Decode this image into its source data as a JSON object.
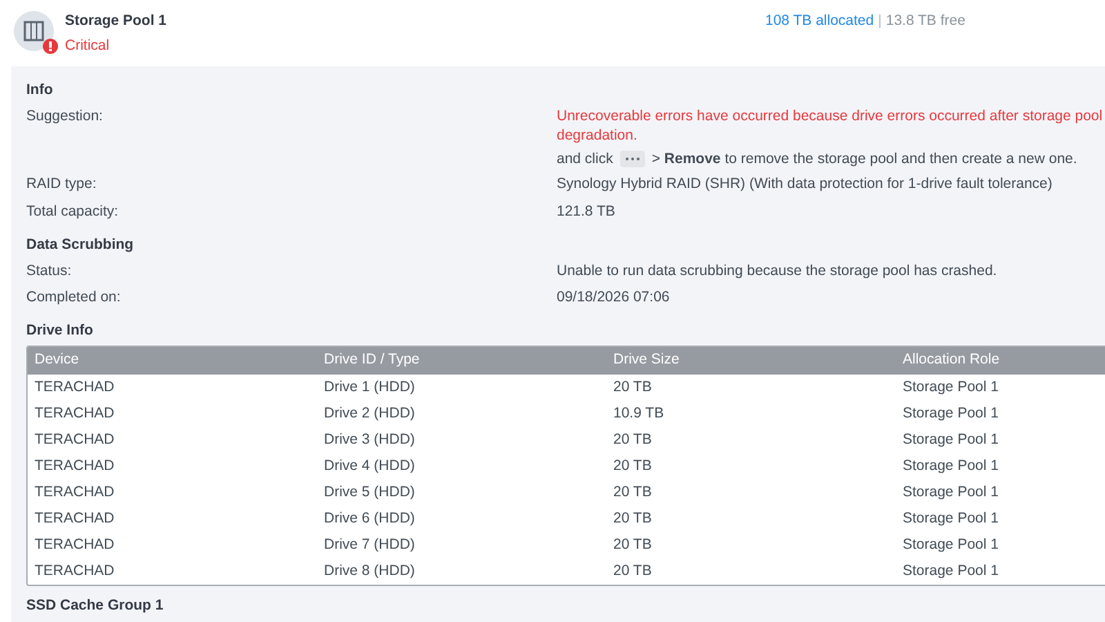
{
  "header": {
    "title": "Storage Pool 1",
    "status": "Critical",
    "allocated": "108 TB allocated",
    "separator": "|",
    "free": "13.8 TB free"
  },
  "info": {
    "title": "Info",
    "rows": [
      {
        "label": "Suggestion:",
        "kind": "suggestion",
        "error": "Unrecoverable errors have occurred because drive errors occurred after storage pool degradation.",
        "before": "and click",
        "after": "> **Remove** to remove the storage pool and then create a new one."
      },
      {
        "label": "RAID type:",
        "kind": "text",
        "value": "Synology Hybrid RAID (SHR) (With data protection for 1-drive fault tolerance)"
      },
      {
        "label": "Total capacity:",
        "kind": "text",
        "value": "121.8 TB"
      }
    ]
  },
  "scrubbing": {
    "title": "Data Scrubbing",
    "rows": [
      {
        "label": "Status:",
        "kind": "text",
        "value": "Unable to run data scrubbing because the storage pool has crashed."
      },
      {
        "label": "Completed on:",
        "kind": "text",
        "value": "09/18/2026 07:06"
      }
    ]
  },
  "drive_info": {
    "title": "Drive Info",
    "table": {
      "columns": [
        "Device",
        "Drive ID / Type",
        "Drive Size",
        "Allocation Role"
      ],
      "rows": [
        [
          "TERACHAD",
          "Drive 1 (HDD)",
          "20 TB",
          "Storage Pool 1"
        ],
        [
          "TERACHAD",
          "Drive 2 (HDD)",
          "10.9 TB",
          "Storage Pool 1"
        ],
        [
          "TERACHAD",
          "Drive 3 (HDD)",
          "20 TB",
          "Storage Pool 1"
        ],
        [
          "TERACHAD",
          "Drive 4 (HDD)",
          "20 TB",
          "Storage Pool 1"
        ],
        [
          "TERACHAD",
          "Drive 5 (HDD)",
          "20 TB",
          "Storage Pool 1"
        ],
        [
          "TERACHAD",
          "Drive 6 (HDD)",
          "20 TB",
          "Storage Pool 1"
        ],
        [
          "TERACHAD",
          "Drive 7 (HDD)",
          "20 TB",
          "Storage Pool 1"
        ],
        [
          "TERACHAD",
          "Drive 8 (HDD)",
          "20 TB",
          "Storage Pool 1"
        ]
      ]
    }
  },
  "next_section": {
    "title": "SSD Cache Group 1"
  }
}
